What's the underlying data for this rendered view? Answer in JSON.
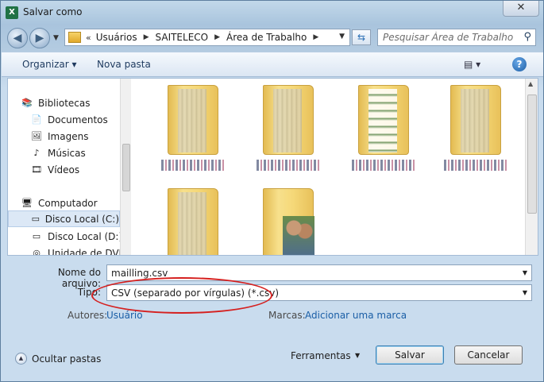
{
  "window": {
    "title": "Salvar como",
    "close_label": "✕"
  },
  "address": {
    "crumbs": [
      "Usuários",
      "SAITELECO",
      "Área de Trabalho"
    ],
    "prefix": "«",
    "search_placeholder": "Pesquisar Área de Trabalho"
  },
  "toolbar": {
    "organize_label": "Organizar ▾",
    "new_folder_label": "Nova pasta",
    "views_label": "▤ ▾",
    "help_label": "?"
  },
  "sidebar": {
    "items": [
      {
        "label": "Bibliotecas",
        "icon": "library-icon",
        "glyph": "📚"
      },
      {
        "label": "Documentos",
        "icon": "documents-icon",
        "glyph": "📄"
      },
      {
        "label": "Imagens",
        "icon": "images-icon",
        "glyph": "🖼"
      },
      {
        "label": "Músicas",
        "icon": "music-icon",
        "glyph": "♪"
      },
      {
        "label": "Vídeos",
        "icon": "videos-icon",
        "glyph": "🎞"
      },
      {
        "label": "Computador",
        "icon": "computer-icon",
        "glyph": "🖥"
      },
      {
        "label": "Disco Local (C:)",
        "icon": "drive-c-icon",
        "glyph": "▭"
      },
      {
        "label": "Disco Local (D:)",
        "icon": "drive-d-icon",
        "glyph": "▭"
      },
      {
        "label": "Unidade de DVD-",
        "icon": "dvd-icon",
        "glyph": "◎"
      }
    ]
  },
  "form": {
    "filename_label": "Nome do arquivo:",
    "filename_value": "mailling.csv",
    "type_label": "Tipo:",
    "type_value": "CSV (separado por vírgulas) (*.csv)",
    "authors_label": "Autores:",
    "authors_value": "Usuário",
    "tags_label": "Marcas:",
    "tags_value": "Adicionar uma marca"
  },
  "footer": {
    "hide_folders_label": "Ocultar pastas",
    "tools_label": "Ferramentas",
    "save_label": "Salvar",
    "cancel_label": "Cancelar"
  },
  "colors": {
    "accent": "#1a5ea6",
    "annotation": "#d5201f",
    "selection": "#dce8f6"
  }
}
